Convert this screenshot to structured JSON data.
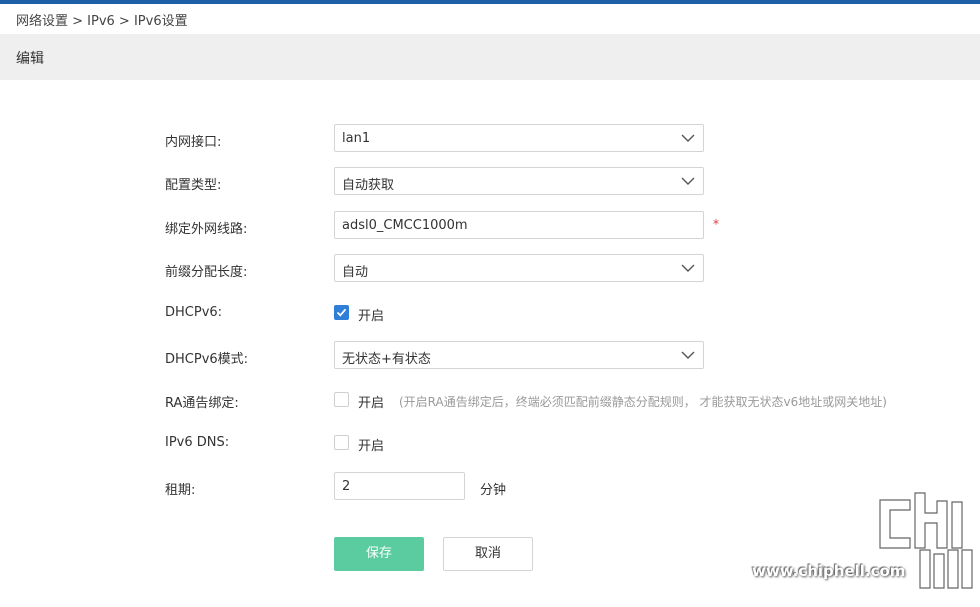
{
  "breadcrumb": "网络设置 > IPv6 > IPv6设置",
  "header": {
    "title": "编辑"
  },
  "form": {
    "lan_interface": {
      "label": "内网接口:",
      "value": "lan1"
    },
    "config_type": {
      "label": "配置类型:",
      "value": "自动获取"
    },
    "wan_binding": {
      "label": "绑定外网线路:",
      "value": "adsl0_CMCC1000m",
      "required_mark": "*"
    },
    "prefix_length": {
      "label": "前缀分配长度:",
      "value": "自动"
    },
    "dhcpv6": {
      "label": "DHCPv6:",
      "checked": true,
      "option_label": "开启"
    },
    "dhcpv6_mode": {
      "label": "DHCPv6模式:",
      "value": "无状态+有状态"
    },
    "ra_binding": {
      "label": "RA通告绑定:",
      "checked": false,
      "option_label": "开启",
      "hint": "(开启RA通告绑定后，终端必须匹配前缀静态分配规则， 才能获取无状态v6地址或网关地址)"
    },
    "ipv6_dns": {
      "label": "IPv6 DNS:",
      "checked": false,
      "option_label": "开启"
    },
    "lease": {
      "label": "租期:",
      "value": "2",
      "unit": "分钟"
    }
  },
  "buttons": {
    "save": "保存",
    "cancel": "取消"
  },
  "watermark": {
    "url": "www.chiphell.com"
  },
  "colors": {
    "accent_bar": "#1f5fa8",
    "save_button": "#5bcca0",
    "checkbox_on": "#2f7fd8",
    "required": "#e23b3b"
  }
}
